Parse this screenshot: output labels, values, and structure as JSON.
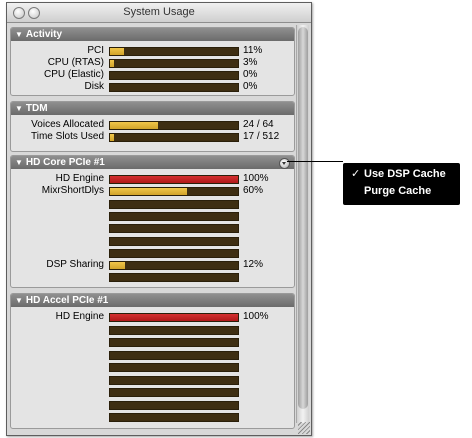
{
  "window": {
    "title": "System Usage"
  },
  "colors": {
    "yellow": "#d2a42a",
    "red": "#b01818",
    "meter_bg": "#3e2e12"
  },
  "activity": {
    "title": "Activity",
    "rows": [
      {
        "label": "PCI",
        "value": "11%",
        "level": 11
      },
      {
        "label": "CPU (RTAS)",
        "value": "3%",
        "level": 3
      },
      {
        "label": "CPU (Elastic)",
        "value": "0%",
        "level": 0
      },
      {
        "label": "Disk",
        "value": "0%",
        "level": 0
      }
    ]
  },
  "tdm": {
    "title": "TDM",
    "rows": [
      {
        "label": "Voices Allocated",
        "value": "24 / 64",
        "level": 37.5
      },
      {
        "label": "Time Slots Used",
        "value": "17 / 512",
        "level": 3.3
      }
    ]
  },
  "hd_core": {
    "title": "HD Core PCIe #1",
    "rows": [
      {
        "label": "HD Engine",
        "value": "100%",
        "level": 100,
        "color": "red"
      },
      {
        "label": "MixrShortDlys",
        "value": "60%",
        "level": 60
      },
      {
        "label": "",
        "value": "",
        "level": 0
      },
      {
        "label": "",
        "value": "",
        "level": 0
      },
      {
        "label": "",
        "value": "",
        "level": 0
      },
      {
        "label": "",
        "value": "",
        "level": 0
      },
      {
        "label": "",
        "value": "",
        "level": 0
      },
      {
        "label": "DSP Sharing",
        "value": "12%",
        "level": 12
      },
      {
        "label": "",
        "value": "",
        "level": 0
      }
    ]
  },
  "hd_accel": {
    "title": "HD Accel PCIe #1",
    "rows": [
      {
        "label": "HD Engine",
        "value": "100%",
        "level": 100,
        "color": "red"
      },
      {
        "label": "",
        "value": "",
        "level": 0
      },
      {
        "label": "",
        "value": "",
        "level": 0
      },
      {
        "label": "",
        "value": "",
        "level": 0
      },
      {
        "label": "",
        "value": "",
        "level": 0
      },
      {
        "label": "",
        "value": "",
        "level": 0
      },
      {
        "label": "",
        "value": "",
        "level": 0
      },
      {
        "label": "",
        "value": "",
        "level": 0
      },
      {
        "label": "",
        "value": "",
        "level": 0
      }
    ]
  },
  "menu": {
    "items": [
      {
        "label": "Use DSP Cache",
        "checked": true,
        "check_mark": "✓"
      },
      {
        "label": "Purge Cache",
        "checked": false,
        "check_mark": ""
      }
    ]
  }
}
